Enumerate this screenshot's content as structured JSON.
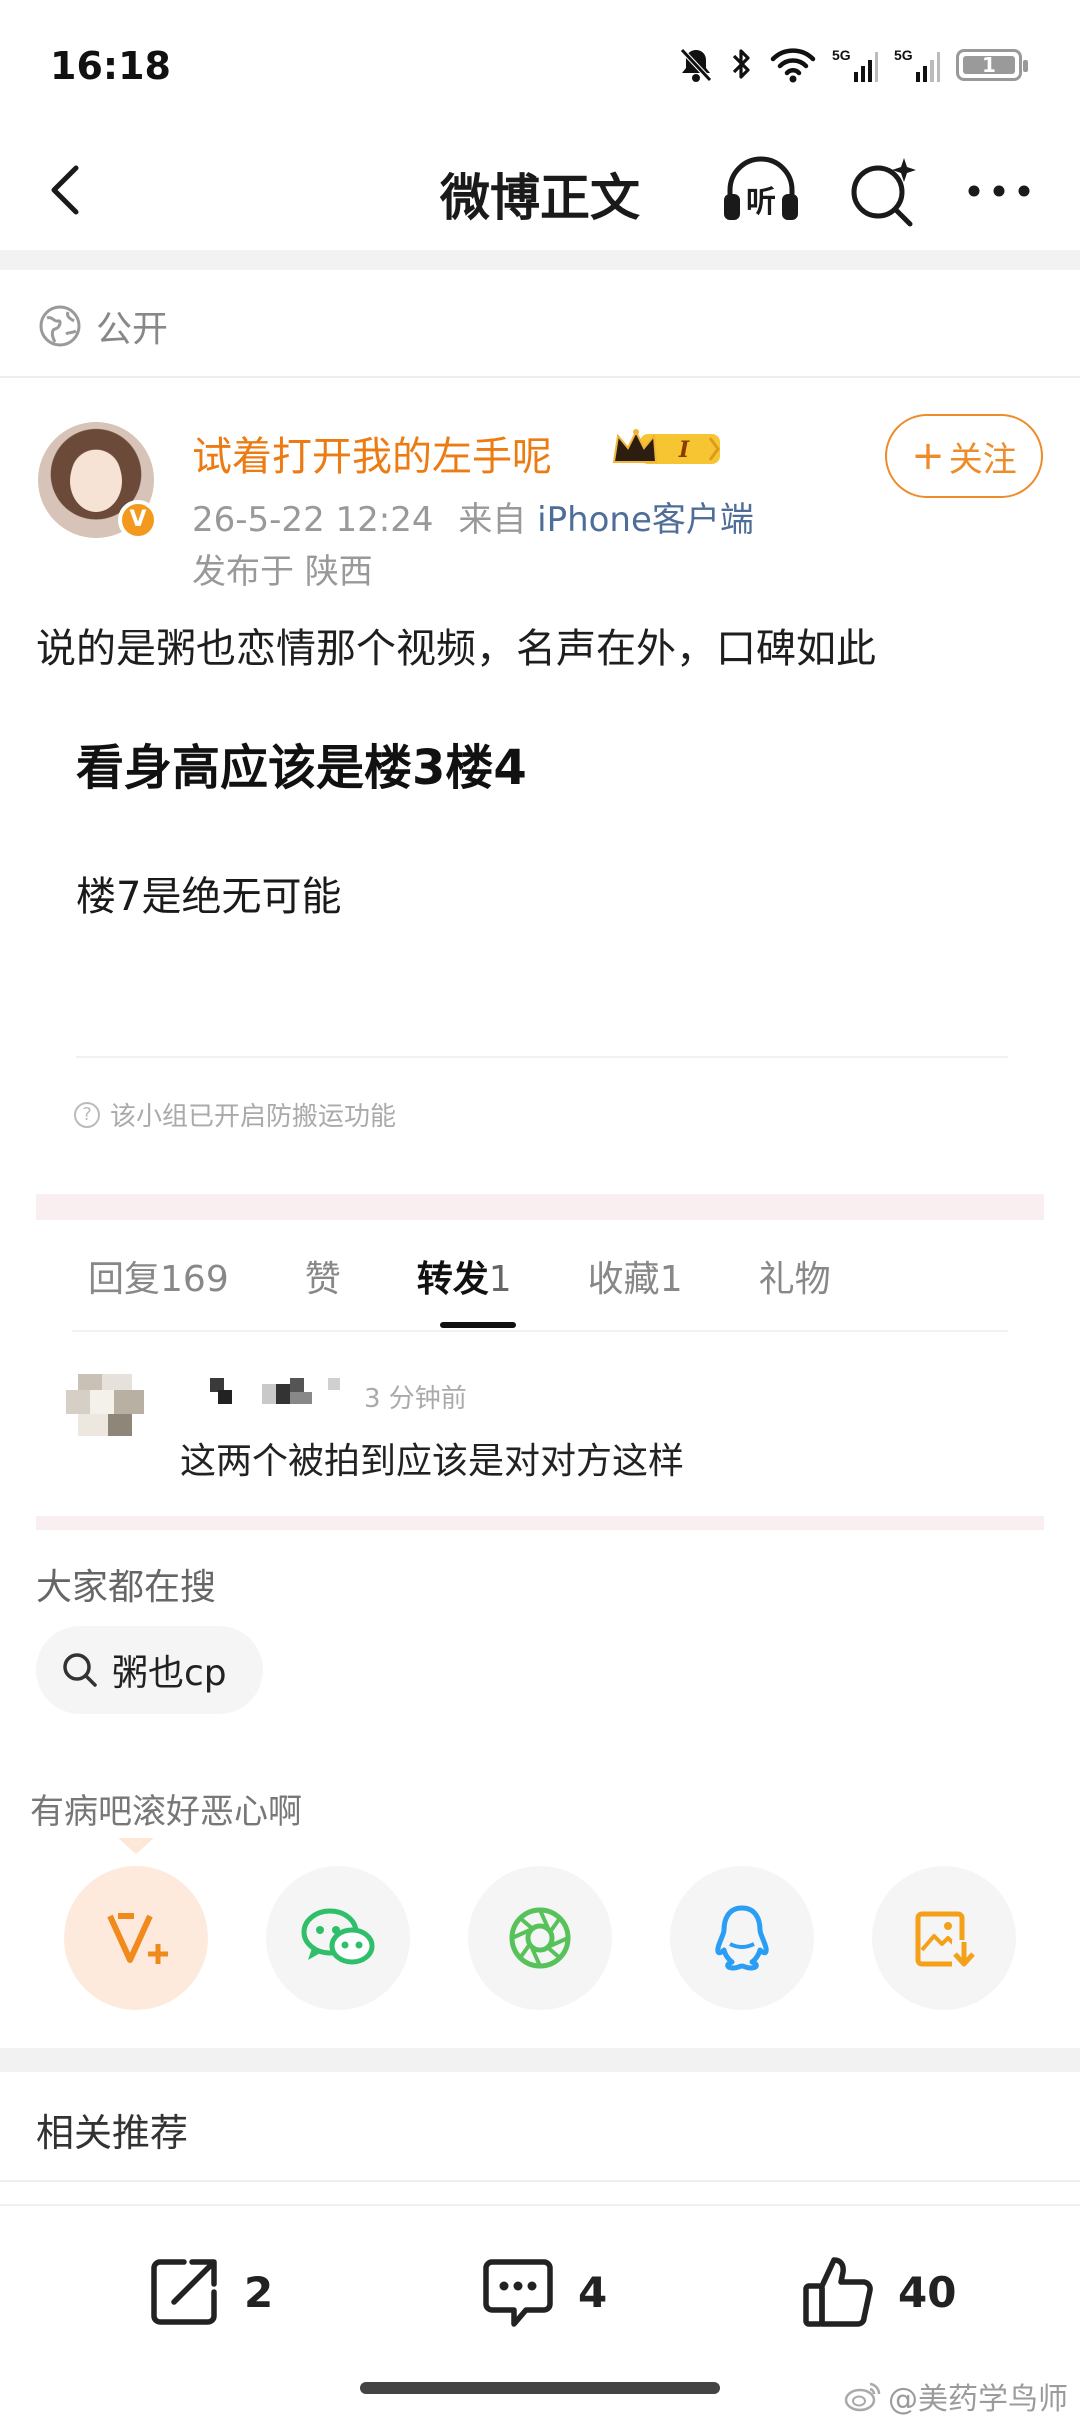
{
  "status_bar": {
    "time": "16:18",
    "battery": "1"
  },
  "nav": {
    "title": "微博正文",
    "listen_label": "听"
  },
  "post": {
    "visibility": "公开",
    "author": {
      "name": "试着打开我的左手呢",
      "vip_level": "I",
      "verified": "V"
    },
    "time": "26-5-22 12:24",
    "source_prefix": "来自",
    "source": "iPhone客户端",
    "location_prefix": "发布于",
    "location": "陕西",
    "follow_label": "关注",
    "text": "说的是粥也恋情那个视频，名声在外，口碑如此",
    "quote_title": "看身高应该是楼3楼4",
    "quote_line": "楼7是绝无可能",
    "group_note": "该小组已开启防搬运功能"
  },
  "tabs": [
    {
      "label": "回复",
      "count": "169"
    },
    {
      "label": "赞",
      "count": ""
    },
    {
      "label": "转发",
      "count": "1"
    },
    {
      "label": "收藏",
      "count": "1"
    },
    {
      "label": "礼物",
      "count": ""
    }
  ],
  "repost": {
    "time": "3 分钟前",
    "text": "这两个被拍到应该是对对方这样"
  },
  "search": {
    "header": "大家都在搜",
    "chip": "粥也cp"
  },
  "share": {
    "hint": "有病吧滚好恶心啊",
    "icons": [
      "v-plus-icon",
      "wechat-icon",
      "moments-icon",
      "qq-icon",
      "save-image-icon"
    ]
  },
  "related": {
    "header": "相关推荐"
  },
  "bottom": {
    "repost_count": "2",
    "comment_count": "4",
    "like_count": "40"
  },
  "watermark": "@美药学鸟师",
  "colors": {
    "accent": "#eb7b12",
    "source_link": "#4e6d99"
  }
}
